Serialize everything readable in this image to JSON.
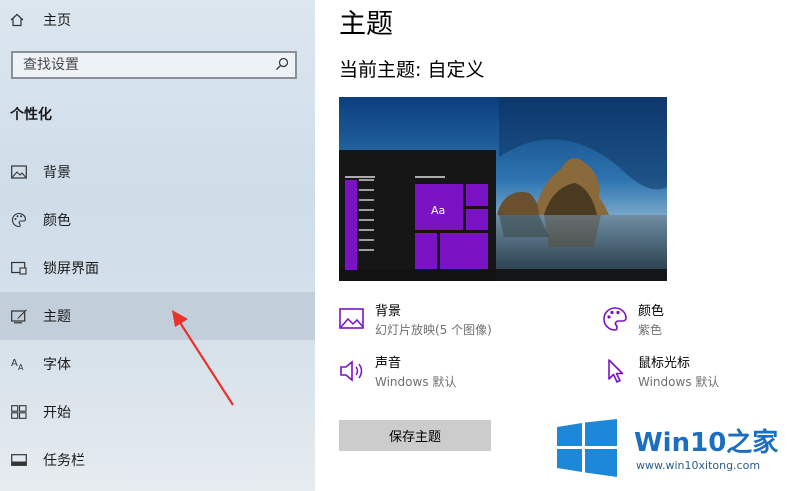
{
  "sidebar": {
    "home_label": "主页",
    "search_placeholder": "查找设置",
    "section_title": "个性化",
    "items": [
      {
        "label": "背景",
        "icon": "picture-icon"
      },
      {
        "label": "颜色",
        "icon": "palette-icon"
      },
      {
        "label": "锁屏界面",
        "icon": "lockscreen-icon"
      },
      {
        "label": "主题",
        "icon": "theme-icon",
        "active": true
      },
      {
        "label": "字体",
        "icon": "font-icon"
      },
      {
        "label": "开始",
        "icon": "start-icon"
      },
      {
        "label": "任务栏",
        "icon": "taskbar-icon"
      }
    ]
  },
  "main": {
    "title": "主题",
    "current_theme": "当前主题: 自定义",
    "preview_tile_label": "Aa",
    "accent_color": "#7a13c4",
    "settings": [
      {
        "title": "背景",
        "subtitle": "幻灯片放映(5 个图像)",
        "icon": "picture-icon"
      },
      {
        "title": "颜色",
        "subtitle": "紫色",
        "icon": "palette-icon"
      },
      {
        "title": "声音",
        "subtitle": "Windows 默认",
        "icon": "speaker-icon"
      },
      {
        "title": "鼠标光标",
        "subtitle": "Windows 默认",
        "icon": "cursor-icon"
      }
    ],
    "save_button": "保存主题"
  },
  "watermark": {
    "brand": "Win10",
    "brand_suffix": "之家",
    "url": "www.win10xitong.com"
  }
}
